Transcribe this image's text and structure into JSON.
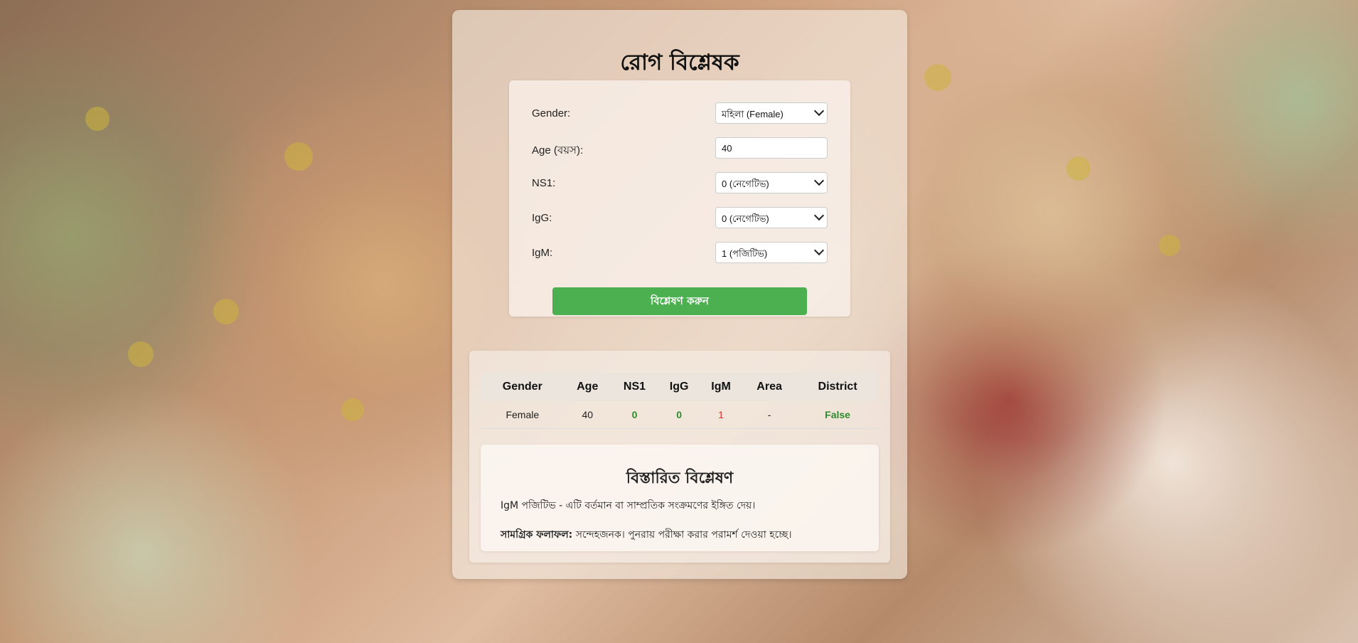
{
  "app": {
    "title": "রোগ বিশ্লেষক"
  },
  "form": {
    "gender": {
      "label": "Gender:",
      "value": "মহিলা (Female)"
    },
    "age": {
      "label": "Age (বয়স):",
      "value": "40"
    },
    "ns1": {
      "label": "NS1:",
      "value": "0 (নেগেটিভ)"
    },
    "igg": {
      "label": "IgG:",
      "value": "0 (নেগেটিভ)"
    },
    "igm": {
      "label": "IgM:",
      "value": "1 (পজিটিভ)"
    },
    "submit_label": "বিশ্লেষণ করুন"
  },
  "results": {
    "headers": [
      "Gender",
      "Age",
      "NS1",
      "IgG",
      "IgM",
      "Area",
      "District"
    ],
    "row": [
      "Female",
      "40",
      "0",
      "0",
      "1",
      "-",
      "False"
    ]
  },
  "detail": {
    "title": "বিস্তারিত বিশ্লেষণ",
    "line1": "IgM পজিটিভ - এটি বর্তমান বা সাম্প্রতিক সংক্রমণের ইঙ্গিত দেয়।",
    "summary_label": "সামগ্রিক ফলাফল:",
    "summary_text": "সন্দেহজনক। পুনরায় পরীক্ষা করার পরামর্শ দেওয়া হচ্ছে।"
  },
  "colors": {
    "accent": "#4caf50",
    "positive": "#d32f2f",
    "negative": "#2e8b2e"
  }
}
